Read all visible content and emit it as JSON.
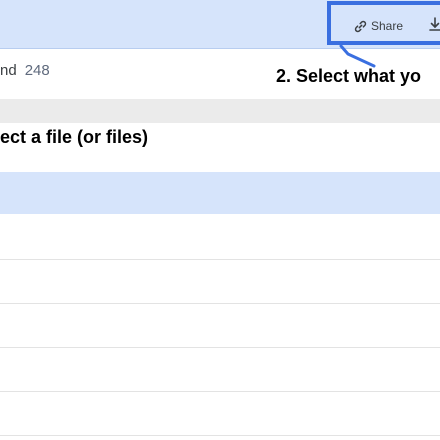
{
  "toolbar": {
    "share_label": "Share",
    "share_icon": "link-icon",
    "download_icon": "download-icon",
    "accent_color": "#3a6fe0",
    "background_color": "#d6e4fb"
  },
  "file_list": {
    "count_label_fragment": "nd",
    "count": "248"
  },
  "annotations": {
    "step1": "ect a file (or files)",
    "step2": "2. Select what yo"
  }
}
